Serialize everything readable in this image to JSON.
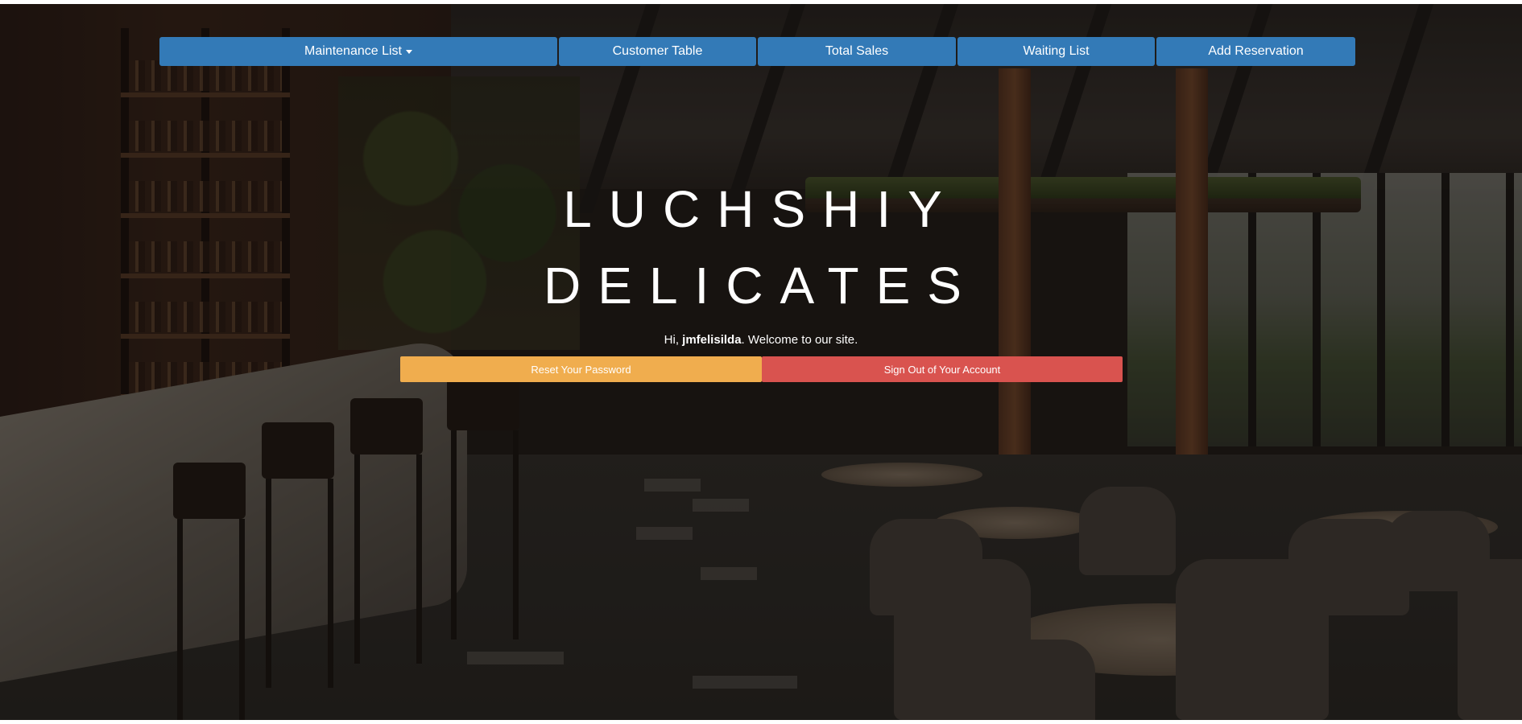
{
  "nav": {
    "items": [
      {
        "label": "Maintenance List",
        "has_dropdown": true
      },
      {
        "label": "Customer Table"
      },
      {
        "label": "Total Sales"
      },
      {
        "label": "Waiting List"
      },
      {
        "label": "Add Reservation"
      }
    ]
  },
  "hero": {
    "title_line1": "LUCHSHIY",
    "title_line2": "DELICATES"
  },
  "welcome": {
    "prefix": "Hi, ",
    "username": "jmfelisilda",
    "suffix": ". Welcome to our site."
  },
  "actions": {
    "reset_password": "Reset Your Password",
    "sign_out": "Sign Out of Your Account"
  },
  "colors": {
    "nav_primary": "#337ab7",
    "warning": "#f0ad4e",
    "danger": "#d9534f",
    "text": "#ffffff"
  }
}
